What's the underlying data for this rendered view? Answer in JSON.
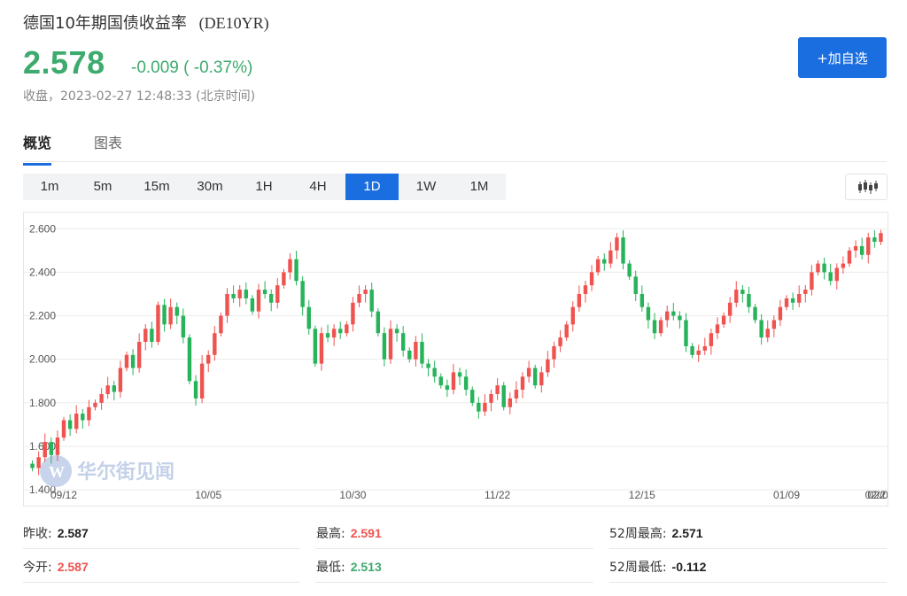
{
  "header": {
    "title": "德国10年期国债收益率",
    "symbol": "(DE10YR)",
    "price": "2.578",
    "change": "-0.009 ( -0.37%)",
    "status": "收盘，2023-02-27 12:48:33 (北京时间)",
    "add_button": "+加自选"
  },
  "tabs": [
    {
      "label": "概览",
      "active": true
    },
    {
      "label": "图表",
      "active": false
    }
  ],
  "intervals": [
    {
      "label": "1m",
      "active": false
    },
    {
      "label": "5m",
      "active": false
    },
    {
      "label": "15m",
      "active": false
    },
    {
      "label": "30m",
      "active": false
    },
    {
      "label": "1H",
      "active": false
    },
    {
      "label": "4H",
      "active": false
    },
    {
      "label": "1D",
      "active": true
    },
    {
      "label": "1W",
      "active": false
    },
    {
      "label": "1M",
      "active": false
    }
  ],
  "toolbar": {
    "chart_type_icon": "candlestick-icon"
  },
  "watermark": "华尔街见闻",
  "colors": {
    "up": "#ef5350",
    "down": "#26b35a",
    "accent": "#1b6ee0",
    "price": "#3daa6e"
  },
  "stats": {
    "prev_close_label": "昨收:",
    "prev_close": "2.587",
    "open_label": "今开:",
    "open": "2.587",
    "high_label": "最高:",
    "high": "2.591",
    "low_label": "最低:",
    "low": "2.513",
    "w52_high_label": "52周最高:",
    "w52_high": "2.571",
    "w52_low_label": "52周最低:",
    "w52_low": "-0.112"
  },
  "chart_data": {
    "type": "candlestick",
    "y_ticks": [
      "2.600",
      "2.400",
      "2.200",
      "2.000",
      "1.800",
      "1.600",
      "1.400"
    ],
    "ylim": [
      1.38,
      2.65
    ],
    "x_tick_labels": [
      "09/12",
      "10/05",
      "10/30",
      "11/22",
      "12/15",
      "01/09",
      "02/01",
      "02/2"
    ],
    "x_tick_index": [
      5,
      28,
      51,
      74,
      97,
      120,
      143,
      163
    ],
    "grid": true,
    "closes": [
      1.5,
      1.55,
      1.62,
      1.56,
      1.64,
      1.72,
      1.68,
      1.75,
      1.72,
      1.78,
      1.8,
      1.84,
      1.88,
      1.85,
      1.96,
      2.02,
      1.96,
      2.08,
      2.14,
      2.08,
      2.25,
      2.16,
      2.24,
      2.2,
      2.1,
      1.9,
      1.82,
      1.98,
      2.02,
      2.12,
      2.2,
      2.3,
      2.28,
      2.32,
      2.28,
      2.22,
      2.32,
      2.3,
      2.26,
      2.34,
      2.4,
      2.46,
      2.36,
      2.24,
      2.14,
      1.98,
      2.12,
      2.1,
      2.14,
      2.12,
      2.16,
      2.26,
      2.3,
      2.32,
      2.22,
      2.12,
      2.0,
      2.14,
      2.12,
      2.04,
      2.0,
      2.08,
      1.98,
      1.96,
      1.92,
      1.88,
      1.86,
      1.94,
      1.92,
      1.86,
      1.8,
      1.76,
      1.8,
      1.84,
      1.88,
      1.78,
      1.82,
      1.86,
      1.92,
      1.96,
      1.88,
      1.94,
      2.0,
      2.06,
      2.1,
      2.16,
      2.24,
      2.3,
      2.34,
      2.4,
      2.46,
      2.44,
      2.5,
      2.56,
      2.44,
      2.38,
      2.3,
      2.24,
      2.18,
      2.12,
      2.18,
      2.22,
      2.2,
      2.18,
      2.06,
      2.02,
      2.04,
      2.06,
      2.12,
      2.16,
      2.2,
      2.26,
      2.32,
      2.3,
      2.24,
      2.18,
      2.1,
      2.14,
      2.18,
      2.24,
      2.28,
      2.26,
      2.3,
      2.32,
      2.4,
      2.44,
      2.4,
      2.36,
      2.42,
      2.44,
      2.5,
      2.52,
      2.48,
      2.56,
      2.54,
      2.58
    ],
    "series": [
      {
        "name": "DE10YR"
      }
    ]
  }
}
